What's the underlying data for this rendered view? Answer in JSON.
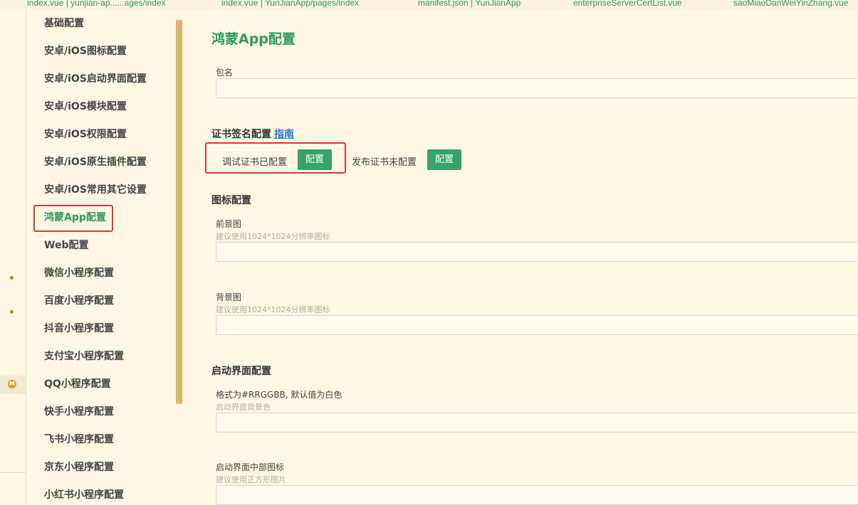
{
  "tabs": [
    "index.vue | yunjian-ap......ages/index",
    "index.vue | YunJianApp/pages/index",
    "manifest.json | YunJianApp",
    "enterpriseServerCertList.vue",
    "saoMiaoDanWeiYinZhang.vue"
  ],
  "sidebar": {
    "items": [
      {
        "label": "基础配置"
      },
      {
        "label": "安卓/iOS图标配置"
      },
      {
        "label": "安卓/iOS启动界面配置"
      },
      {
        "label": "安卓/iOS模块配置"
      },
      {
        "label": "安卓/iOS权限配置"
      },
      {
        "label": "安卓/iOS原生插件配置"
      },
      {
        "label": "安卓/iOS常用其它设置"
      },
      {
        "label": "鸿蒙App配置",
        "active": true
      },
      {
        "label": "Web配置"
      },
      {
        "label": "微信小程序配置"
      },
      {
        "label": "百度小程序配置"
      },
      {
        "label": "抖音小程序配置"
      },
      {
        "label": "支付宝小程序配置"
      },
      {
        "label": "QQ小程序配置"
      },
      {
        "label": "快手小程序配置"
      },
      {
        "label": "飞书小程序配置"
      },
      {
        "label": "京东小程序配置"
      },
      {
        "label": "小红书小程序配置"
      }
    ]
  },
  "gutter": {
    "badge": "M"
  },
  "main": {
    "title": "鸿蒙App配置",
    "package": {
      "label": "包名",
      "value": ""
    },
    "cert": {
      "title": "证书签名配置",
      "guide_link": "指南",
      "debug_status": "调试证书已配置",
      "debug_button": "配置",
      "release_status": "发布证书未配置",
      "release_button": "配置"
    },
    "icon": {
      "title": "图标配置",
      "foreground": {
        "label": "前景图",
        "hint": "建议使用1024*1024分辨率图标",
        "value": ""
      },
      "background": {
        "label": "背景图",
        "hint": "建议使用1024*1024分辨率图标",
        "value": ""
      }
    },
    "splash": {
      "title": "启动界面配置",
      "bg_color": {
        "label": "格式为#RRGGBB, 默认值为白色",
        "hint": "启动界面背景色",
        "value": ""
      },
      "center_icon": {
        "label": "启动界面中部图标",
        "hint": "建议使用正方形图片",
        "value": ""
      }
    }
  },
  "colors": {
    "accent": "#2e9b5a",
    "button": "#36a467",
    "highlight_border": "#e03636",
    "link": "#2a6fd6",
    "background": "#fdf7e4"
  }
}
